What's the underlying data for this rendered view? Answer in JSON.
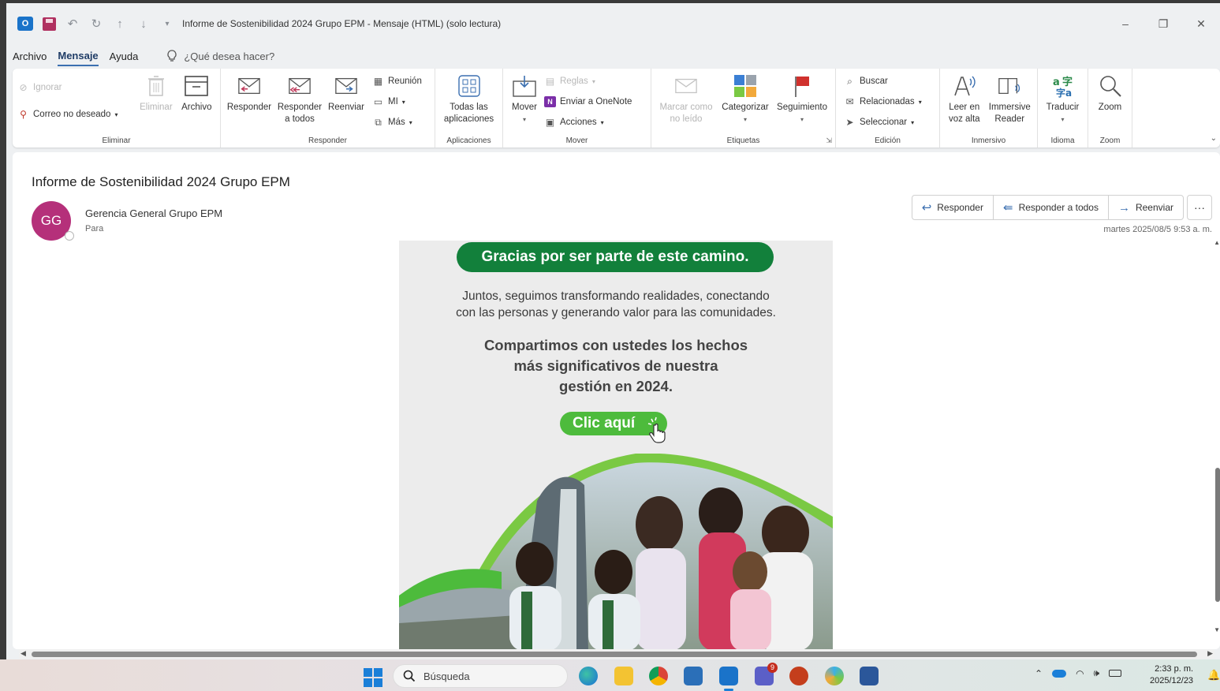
{
  "window": {
    "title": "Informe de Sostenibilidad 2024 Grupo EPM  -  Mensaje (HTML) (solo lectura)",
    "app_icon": "outlook-icon",
    "controls": [
      "–",
      "❐",
      "✕"
    ]
  },
  "menu": {
    "items": [
      "Archivo",
      "Mensaje",
      "Ayuda"
    ],
    "active": "Mensaje",
    "tellme": "¿Qué desea hacer?"
  },
  "ribbon": {
    "eliminar": {
      "label": "Eliminar",
      "ignorar": "Ignorar",
      "correo_no_deseado": "Correo no deseado",
      "eliminar_btn": "Eliminar",
      "archivo": "Archivo"
    },
    "responder": {
      "label": "Responder",
      "responder": "Responder",
      "responder_todos_1": "Responder",
      "responder_todos_2": "a todos",
      "reenviar": "Reenviar",
      "reunion": "Reunión",
      "mi": "MI",
      "mas": "Más"
    },
    "aplicaciones": {
      "label": "Aplicaciones",
      "todas_1": "Todas las",
      "todas_2": "aplicaciones"
    },
    "mover": {
      "label": "Mover",
      "mover": "Mover",
      "reglas": "Reglas",
      "onenote": "Enviar a OneNote",
      "acciones": "Acciones"
    },
    "etiquetas": {
      "label": "Etiquetas",
      "marcar_1": "Marcar como",
      "marcar_2": "no leído",
      "categorizar": "Categorizar",
      "seguimiento": "Seguimiento"
    },
    "edicion": {
      "label": "Edición",
      "buscar": "Buscar",
      "relacionadas": "Relacionadas",
      "seleccionar": "Seleccionar"
    },
    "inmersivo": {
      "label": "Inmersivo",
      "leer_1": "Leer en",
      "leer_2": "voz alta",
      "immersive_1": "Immersive",
      "immersive_2": "Reader"
    },
    "idioma": {
      "label": "Idioma",
      "traducir": "Traducir"
    },
    "zoom": {
      "label": "Zoom",
      "zoom": "Zoom"
    }
  },
  "message": {
    "subject": "Informe de Sostenibilidad 2024 Grupo EPM",
    "avatar_initials": "GG",
    "sender": "Gerencia General Grupo EPM",
    "to_label": "Para",
    "date": "martes 2025/08/5 9:53 a. m.",
    "actions": [
      "Responder",
      "Responder a todos",
      "Reenviar"
    ],
    "more": "···"
  },
  "email_body": {
    "banner": "Gracias por ser parte de este camino.",
    "para1_line1": "Juntos, seguimos transformando realidades, conectando",
    "para1_line2": "con las personas y generando valor para las comunidades.",
    "para2_line1": "Compartimos con ustedes los hechos",
    "para2_line2": "más significativos de nuestra",
    "para2_line3": "gestión en 2024.",
    "cta": "Clic aquí",
    "colors": {
      "dark_green": "#12803b",
      "light_green": "#4dbb3c",
      "lime": "#7ac943"
    }
  },
  "taskbar": {
    "search_placeholder": "Búsqueda",
    "clock_time": "2:33 p. m.",
    "clock_date": "2025/12/23",
    "apps": [
      "edge-icon",
      "file-explorer-icon",
      "chrome-icon",
      "store-icon",
      "outlook-icon",
      "teams-icon",
      "powerpoint-icon",
      "copilot-icon",
      "word-icon"
    ],
    "teams_badge": "9"
  }
}
